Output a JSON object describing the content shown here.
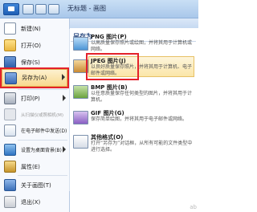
{
  "window": {
    "title": "无标题 - 画图"
  },
  "menu": {
    "items": [
      {
        "label": "新建(N)",
        "icon": "new-doc-icon"
      },
      {
        "label": "打开(O)",
        "icon": "open-folder-icon"
      },
      {
        "label": "保存(S)",
        "icon": "save-icon"
      },
      {
        "label": "另存为(A)",
        "icon": "save-as-icon"
      },
      {
        "label": "打印(P)",
        "icon": "print-icon"
      },
      {
        "label": "从扫描仪或照相机(M)",
        "icon": "scanner-icon"
      },
      {
        "label": "在电子邮件中发送(D)",
        "icon": "email-icon"
      },
      {
        "label": "设置为桌面背景(B)",
        "icon": "desktop-background-icon"
      },
      {
        "label": "属性(E)",
        "icon": "properties-icon"
      },
      {
        "label": "关于画图(T)",
        "icon": "about-icon"
      },
      {
        "label": "退出(X)",
        "icon": "exit-icon"
      }
    ]
  },
  "save_as": {
    "header": "另存为",
    "options": [
      {
        "title": "PNG 图片(P)",
        "desc": "以高质量保存照片或绘图，并将其用于计算机或网络。"
      },
      {
        "title": "JPEG 图片(J)",
        "desc": "以良好质量保存照片，并将其用于计算机、电子邮件或网络。"
      },
      {
        "title": "BMP 图片(B)",
        "desc": "以任意质量保存任何类型的图片，并将其用于计算机。"
      },
      {
        "title": "GIF 图片(G)",
        "desc": "保存简单绘图，并将其用于电子邮件或网络。"
      },
      {
        "title": "其他格式(O)",
        "desc": "打开“另存为”对话框，从所有可能的文件类型中进行选择。"
      }
    ]
  },
  "colors": {
    "highlight_border": "#e4222b",
    "selected_bg": "#f8d98e"
  },
  "watermark": "ab"
}
